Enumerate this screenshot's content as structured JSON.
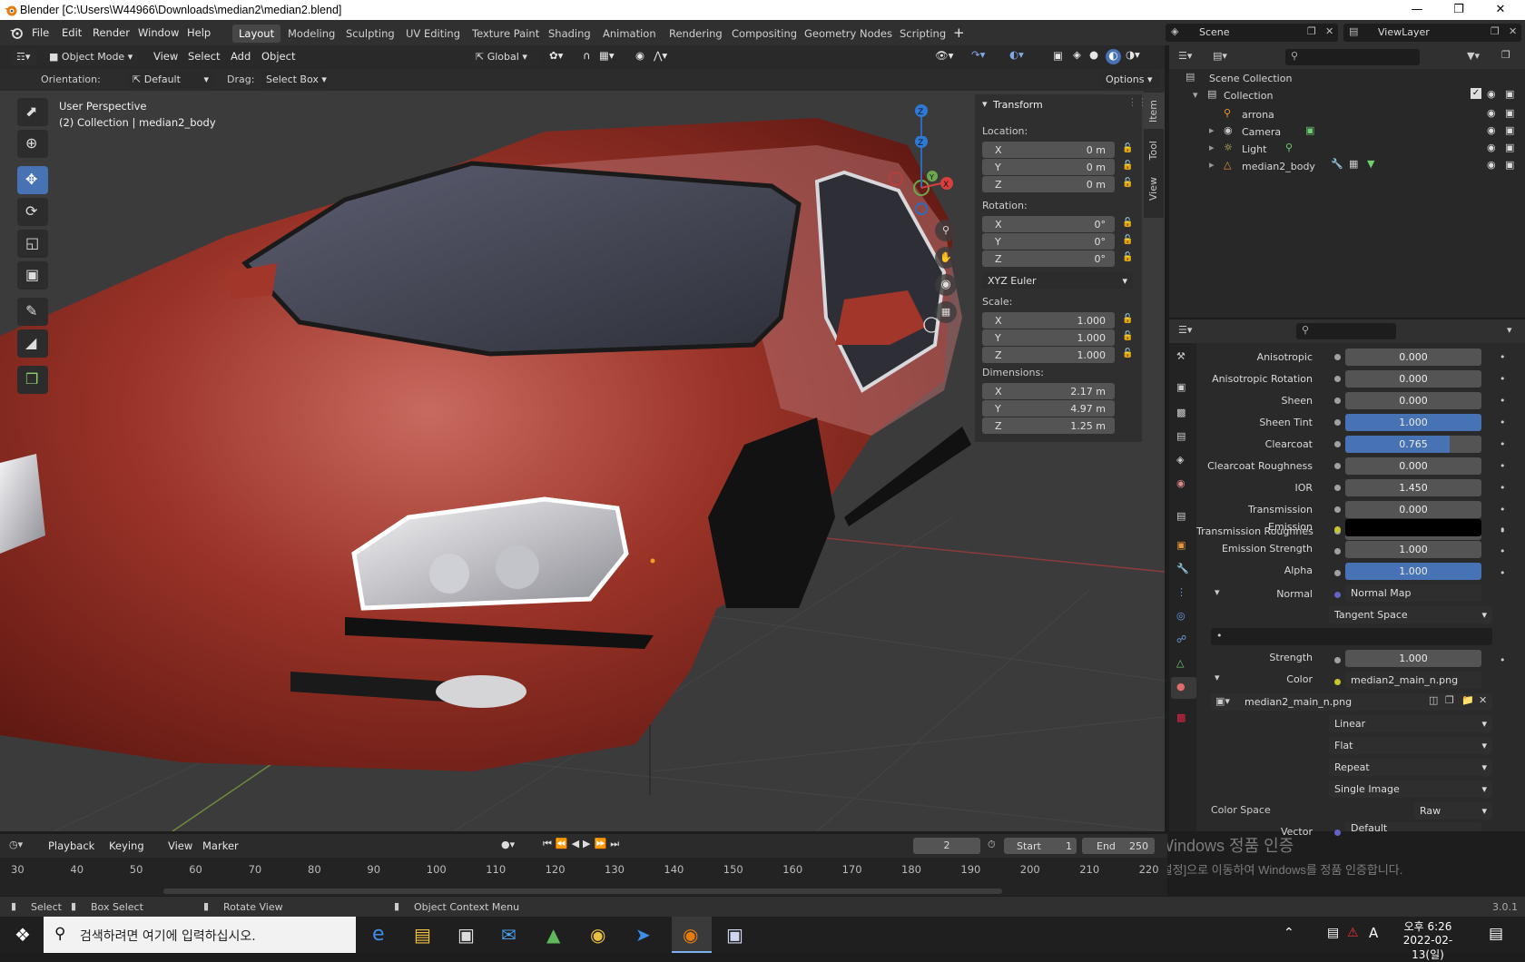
{
  "window": {
    "title": "Blender [C:\\Users\\W44966\\Downloads\\median2\\median2.blend]"
  },
  "menu": [
    "File",
    "Edit",
    "Render",
    "Window",
    "Help"
  ],
  "workspaces": [
    "Layout",
    "Modeling",
    "Sculpting",
    "UV Editing",
    "Texture Paint",
    "Shading",
    "Animation",
    "Rendering",
    "Compositing",
    "Geometry Nodes",
    "Scripting"
  ],
  "scene": {
    "name": "Scene",
    "view_layer": "ViewLayer"
  },
  "viewport_header": {
    "mode": "Object Mode",
    "menus": [
      "View",
      "Select",
      "Add",
      "Object"
    ],
    "transform_orientation": "Global"
  },
  "tool_settings": {
    "orientation_label": "Orientation:",
    "orientation": "Default",
    "drag_label": "Drag:",
    "drag": "Select Box",
    "options": "Options"
  },
  "viewport": {
    "view_name": "User Perspective",
    "object_info": "(2) Collection | median2_body"
  },
  "npanel": {
    "section": "Transform",
    "location_label": "Location:",
    "location": [
      "0 m",
      "0 m",
      "0 m"
    ],
    "rotation_label": "Rotation:",
    "rotation": [
      "0°",
      "0°",
      "0°"
    ],
    "rotation_mode": "XYZ Euler",
    "scale_label": "Scale:",
    "scale": [
      "1.000",
      "1.000",
      "1.000"
    ],
    "dimensions_label": "Dimensions:",
    "dimensions": [
      "2.17 m",
      "4.97 m",
      "1.25 m"
    ],
    "axes": [
      "X",
      "Y",
      "Z"
    ],
    "tabs": [
      "Item",
      "Tool",
      "View"
    ]
  },
  "outliner": {
    "root": "Scene Collection",
    "collection": "Collection",
    "items": [
      "arrona",
      "Camera",
      "Light",
      "median2_body"
    ]
  },
  "properties": {
    "rows": [
      {
        "label": "Anisotropic",
        "value": "0.000",
        "fill": 0
      },
      {
        "label": "Anisotropic Rotation",
        "value": "0.000",
        "fill": 0
      },
      {
        "label": "Sheen",
        "value": "0.000",
        "fill": 0
      },
      {
        "label": "Sheen Tint",
        "value": "1.000",
        "fill": 1
      },
      {
        "label": "Clearcoat",
        "value": "0.765",
        "fill": 0.765
      },
      {
        "label": "Clearcoat Roughness",
        "value": "0.000",
        "fill": 0
      },
      {
        "label": "IOR",
        "value": "1.450",
        "fill": 0
      },
      {
        "label": "Transmission",
        "value": "0.000",
        "fill": 0
      },
      {
        "label": "Transmission Roughnes",
        "value": "0.000",
        "fill": 0
      }
    ],
    "emission_label": "Emission",
    "emission_color": "#000000",
    "emission_strength_label": "Emission Strength",
    "emission_strength": "1.000",
    "alpha_label": "Alpha",
    "alpha": "1.000",
    "normal_label": "Normal",
    "normal_value": "Normal Map",
    "tangent_space": "Tangent Space",
    "strength_label": "Strength",
    "strength": "1.000",
    "color_label": "Color",
    "color_value": "median2_main_n.png",
    "image_name": "median2_main_n.png",
    "interpolation": "Linear",
    "projection": "Flat",
    "extension": "Repeat",
    "source": "Single Image",
    "color_space_label": "Color Space",
    "color_space": "Raw",
    "vector_label": "Vector",
    "vector_value": "Default"
  },
  "timeline": {
    "menus": [
      "Playback",
      "Keying",
      "View",
      "Marker"
    ],
    "current_frame": "2",
    "start_label": "Start",
    "start": "1",
    "end_label": "End",
    "end": "250",
    "ticks": [
      "30",
      "40",
      "50",
      "60",
      "70",
      "80",
      "90",
      "100",
      "110",
      "120",
      "130",
      "140",
      "150",
      "160",
      "170",
      "180",
      "190",
      "200",
      "210",
      "220"
    ]
  },
  "statusbar": {
    "select": "Select",
    "box_select": "Box Select",
    "rotate_view": "Rotate View",
    "context_menu": "Object Context Menu",
    "version": "3.0.1"
  },
  "watermark": {
    "line1": "Windows 정품 인증",
    "line2": "[설정]으로 이동하여 Windows를 정품 인증합니다."
  },
  "taskbar": {
    "search_placeholder": "검색하려면 여기에 입력하십시오.",
    "ime": "A",
    "time": "오후 6:26",
    "date": "2022-02-13(일)"
  }
}
